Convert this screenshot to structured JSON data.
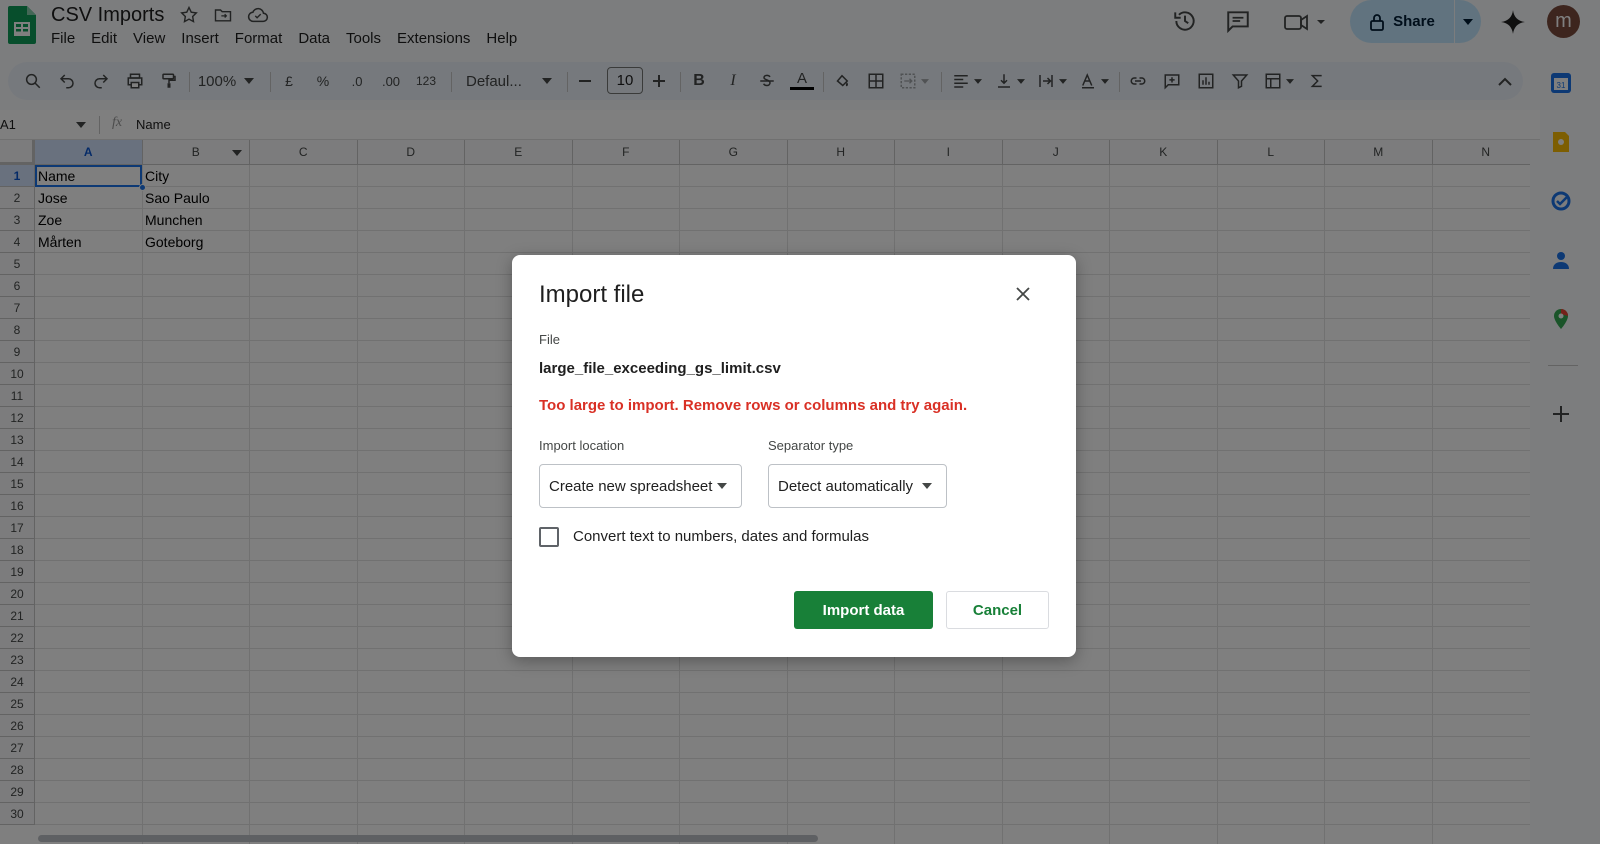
{
  "app": {
    "doc_title": "CSV Imports",
    "avatar_letter": "m",
    "share_label": "Share"
  },
  "menu": [
    "File",
    "Edit",
    "View",
    "Insert",
    "Format",
    "Data",
    "Tools",
    "Extensions",
    "Help"
  ],
  "toolbar": {
    "zoom": "100%",
    "currency": "£",
    "percent": "%",
    "dec_decrease": ".0",
    "dec_increase": ".00",
    "number_format": "123",
    "font_name": "Defaul...",
    "font_size": "10",
    "text_color_letter": "A"
  },
  "formula_bar": {
    "cell_ref": "A1",
    "fx": "fx",
    "content": "Name"
  },
  "grid": {
    "columns": [
      "A",
      "B",
      "C",
      "D",
      "E",
      "F",
      "G",
      "H",
      "I",
      "J",
      "K",
      "L",
      "M",
      "N"
    ],
    "rows": [
      "1",
      "2",
      "3",
      "4",
      "5",
      "6",
      "7",
      "8",
      "9",
      "10",
      "11",
      "12",
      "13",
      "14",
      "15",
      "16",
      "17",
      "18",
      "19",
      "20",
      "21",
      "22",
      "23",
      "24",
      "25",
      "26",
      "27",
      "28",
      "29",
      "30"
    ],
    "cells": [
      [
        "Name",
        "City"
      ],
      [
        "Jose",
        "Sao Paulo"
      ],
      [
        "Zoe",
        "Munchen"
      ],
      [
        "Mårten",
        "Goteborg"
      ]
    ]
  },
  "dialog": {
    "title": "Import file",
    "file_label": "File",
    "file_name": "large_file_exceeding_gs_limit.csv",
    "error": "Too large to import. Remove rows or columns and try again.",
    "location_label": "Import location",
    "location_value": "Create new spreadsheet",
    "separator_label": "Separator type",
    "separator_value": "Detect automatically",
    "convert_label": "Convert text to numbers, dates and formulas",
    "convert_checked": false,
    "import_label": "Import data",
    "cancel_label": "Cancel"
  },
  "colors": {
    "accent_green": "#188038",
    "error_red": "#d93025",
    "share_bg": "#c2e7ff"
  }
}
